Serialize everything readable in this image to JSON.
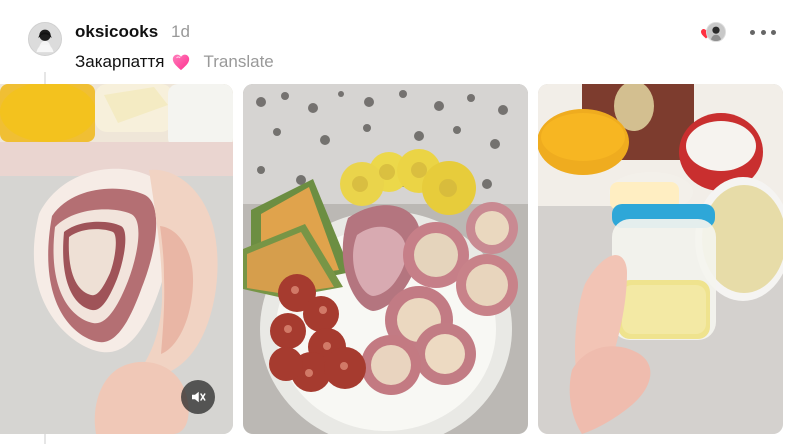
{
  "post": {
    "author": "oksicooks",
    "time": "1d",
    "caption": "Закарпаття",
    "translate_label": "Translate"
  },
  "icons": {
    "avatar": "avatar-image",
    "reaction_heart": "heart-icon",
    "reaction_avatar": "reactor-avatar",
    "more": "more-icon",
    "caption_emoji": "heart-emoji-icon",
    "mute": "mute-icon"
  },
  "colors": {
    "accent_red": "#ff3040",
    "text_primary": "#111111",
    "text_secondary": "#999999",
    "line": "#e6e6e6"
  },
  "media": [
    {
      "type": "video",
      "muted": true
    },
    {
      "type": "image"
    },
    {
      "type": "image"
    }
  ]
}
